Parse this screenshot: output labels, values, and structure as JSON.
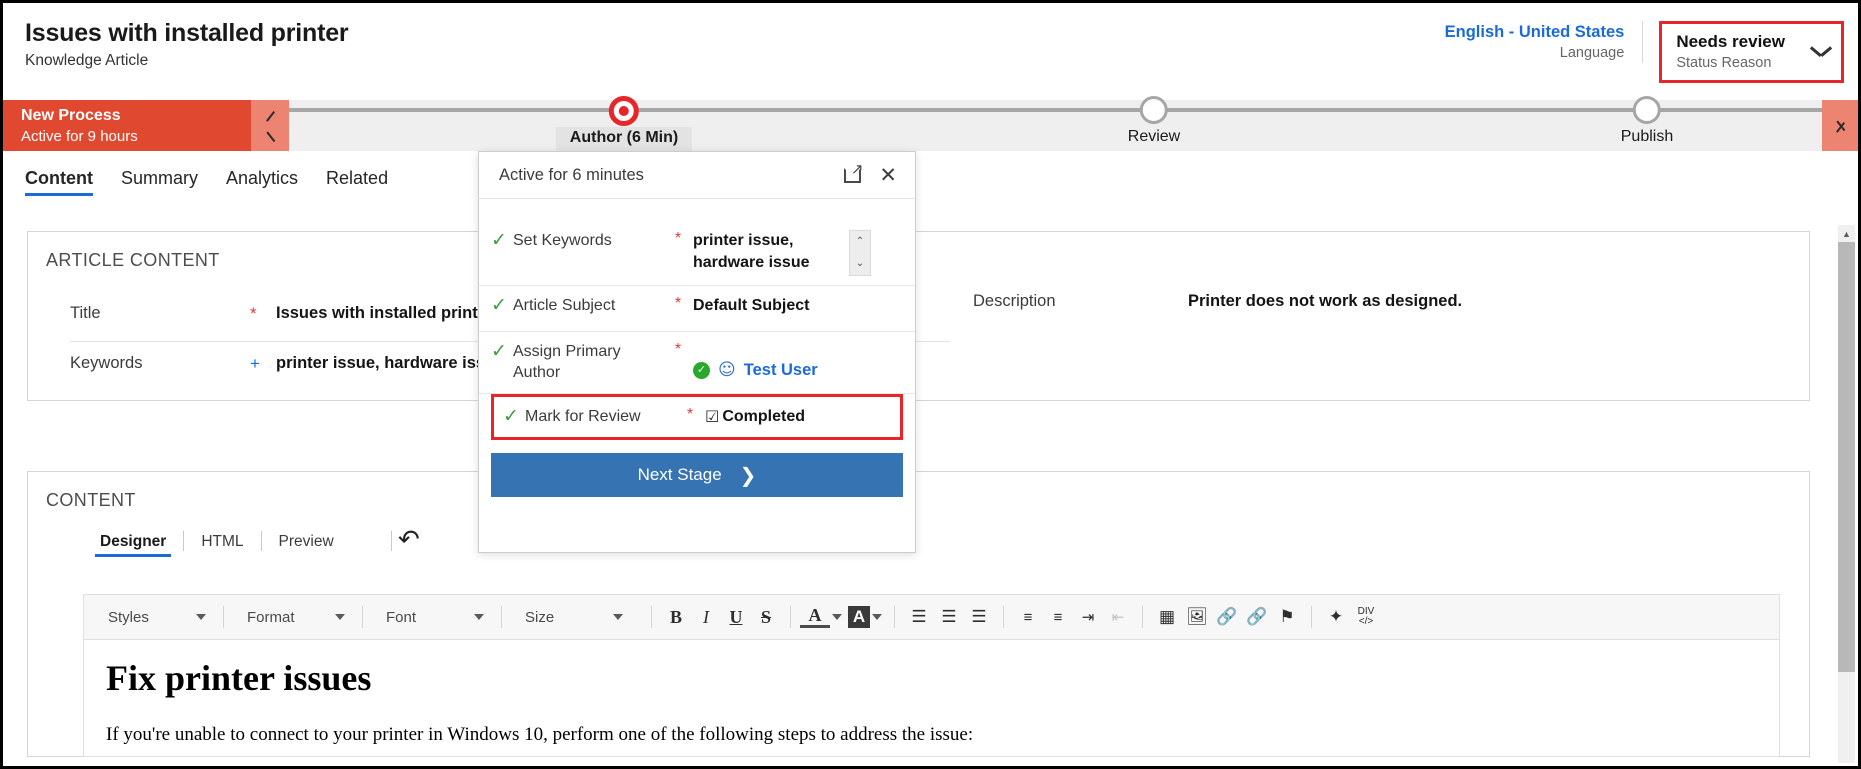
{
  "header": {
    "title": "Issues with installed printer",
    "subtitle": "Knowledge Article",
    "language": {
      "value": "English - United States",
      "label": "Language"
    },
    "status": {
      "value": "Needs review",
      "label": "Status Reason",
      "chevron_icon": "chevron-down-icon",
      "highlight_color": "#e8262a"
    }
  },
  "process_flow": {
    "active_title": "New Process",
    "active_subtitle": "Active for 9 hours",
    "prev_icon": "chevron-left-icon",
    "next_icon": "chevron-right-icon",
    "active_color": "#e0482f",
    "stages": [
      {
        "label": "Author  (6 Min)",
        "state": "current"
      },
      {
        "label": "Review",
        "state": "pending"
      },
      {
        "label": "Publish",
        "state": "pending"
      }
    ]
  },
  "tabs": [
    {
      "label": "Content",
      "selected": true
    },
    {
      "label": "Summary",
      "selected": false
    },
    {
      "label": "Analytics",
      "selected": false
    },
    {
      "label": "Related",
      "selected": false
    }
  ],
  "article_content": {
    "heading": "ARTICLE CONTENT",
    "left_fields": [
      {
        "label": "Title",
        "required": "*",
        "required_color": "red",
        "value": "Issues with installed printer"
      },
      {
        "label": "Keywords",
        "required": "+",
        "required_color": "blue",
        "value": "printer issue, hardware issue"
      }
    ],
    "right_fields": [
      {
        "label": "Description",
        "value": "Printer does not work as designed."
      }
    ]
  },
  "content_section": {
    "heading": "CONTENT",
    "editor_tabs": [
      {
        "label": "Designer",
        "selected": true
      },
      {
        "label": "HTML",
        "selected": false
      },
      {
        "label": "Preview",
        "selected": false
      }
    ],
    "undo_icon": "undo-icon",
    "toolbar": {
      "selects": [
        {
          "label": "Styles",
          "caret_icon": "caret-down-icon"
        },
        {
          "label": "Format",
          "caret_icon": "caret-down-icon"
        },
        {
          "label": "Font",
          "caret_icon": "caret-down-icon"
        },
        {
          "label": "Size",
          "caret_icon": "caret-down-icon"
        }
      ],
      "buttons": [
        {
          "name": "bold-icon",
          "glyph": "B",
          "style": "bold-serif"
        },
        {
          "name": "italic-icon",
          "glyph": "I",
          "style": "italic-serif"
        },
        {
          "name": "underline-icon",
          "glyph": "U",
          "style": "underline-serif"
        },
        {
          "name": "strikethrough-icon",
          "glyph": "S",
          "style": "strike-serif"
        },
        {
          "name": "text-color-icon",
          "glyph": "A",
          "style": "text-color"
        },
        {
          "name": "background-color-icon",
          "glyph": "A",
          "style": "bg-color"
        },
        {
          "name": "align-left-icon",
          "glyph": "☰",
          "style": "plain"
        },
        {
          "name": "align-center-icon",
          "glyph": "☰",
          "style": "plain"
        },
        {
          "name": "align-right-icon",
          "glyph": "☰",
          "style": "plain"
        },
        {
          "name": "numbered-list-icon",
          "glyph": "☰",
          "style": "num"
        },
        {
          "name": "bulleted-list-icon",
          "glyph": "☰",
          "style": "bullet"
        },
        {
          "name": "increase-indent-icon",
          "glyph": "☰",
          "style": "indent"
        },
        {
          "name": "decrease-indent-icon",
          "glyph": "☰",
          "style": "outdent-dim"
        },
        {
          "name": "insert-table-icon",
          "glyph": "▦",
          "style": "plain"
        },
        {
          "name": "insert-image-icon",
          "glyph": "Ὓc",
          "style": "plain"
        },
        {
          "name": "insert-link-icon",
          "glyph": "⚭",
          "style": "plain"
        },
        {
          "name": "remove-link-icon",
          "glyph": "⚭",
          "style": "dim"
        },
        {
          "name": "insert-anchor-icon",
          "glyph": "⚑",
          "style": "plain"
        },
        {
          "name": "clean-formatting-icon",
          "glyph": "✦",
          "style": "plain"
        },
        {
          "name": "div-code-icon",
          "glyph": "DIV",
          "style": "code"
        }
      ]
    },
    "document": {
      "title": "Fix printer issues",
      "paragraph": "If you're unable to connect to your printer in Windows 10, perform one of the following steps to address the issue:"
    }
  },
  "stage_flyout": {
    "header_title": "Active for 6 minutes",
    "popout_icon": "popout-icon",
    "close_icon": "close-icon",
    "steps": [
      {
        "check_icon": "check-icon",
        "label": "Set Keywords",
        "required": "*",
        "value": "printer issue, hardware issue",
        "control": "multiline-with-spinner",
        "spinner_up_icon": "chevron-up-icon",
        "spinner_down_icon": "chevron-down-icon",
        "highlighted": false
      },
      {
        "check_icon": "check-icon",
        "label": "Article Subject",
        "required": "*",
        "value": "Default Subject",
        "control": "text",
        "highlighted": false
      },
      {
        "check_icon": "check-icon",
        "label": "Assign Primary Author",
        "required": "*",
        "value": "Test User",
        "control": "lookup",
        "badge_icon": "verified-badge-icon",
        "person_icon": "person-icon",
        "highlighted": false
      },
      {
        "check_icon": "check-icon",
        "label": "Mark for Review",
        "required": "*",
        "value": "Completed",
        "control": "checkbox",
        "checkbox_icon": "checkbox-checked-icon",
        "highlighted": true,
        "highlight_color": "#e8262a"
      }
    ],
    "next_stage": {
      "label": "Next Stage",
      "chevron_icon": "chevron-right-icon",
      "color": "#3573b3"
    }
  },
  "scrollbar": {
    "up_icon": "scroll-up-arrow-icon"
  }
}
